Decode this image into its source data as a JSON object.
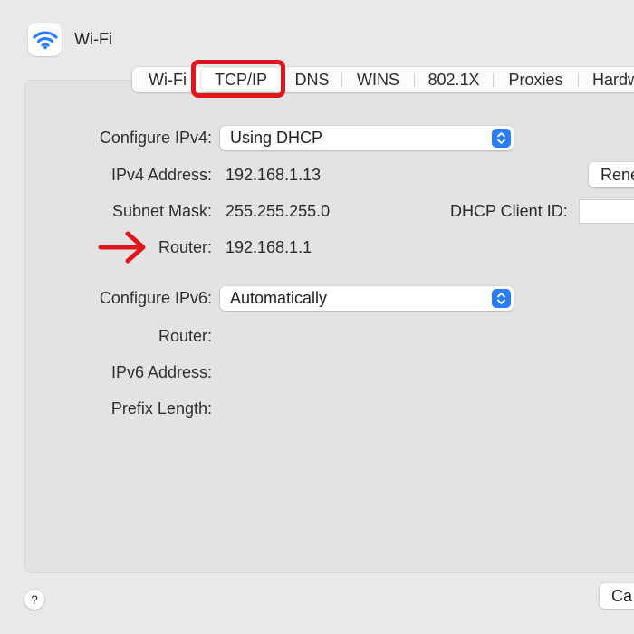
{
  "window": {
    "title": "Wi-Fi",
    "icon": "wifi-icon"
  },
  "tabs": [
    {
      "label": "Wi-Fi"
    },
    {
      "label": "TCP/IP"
    },
    {
      "label": "DNS"
    },
    {
      "label": "WINS"
    },
    {
      "label": "802.1X"
    },
    {
      "label": "Proxies"
    },
    {
      "label": "Hardw"
    }
  ],
  "selected_tab": "TCP/IP",
  "ipv4": {
    "configure_label": "Configure IPv4:",
    "configure_value": "Using DHCP",
    "address_label": "IPv4 Address:",
    "address_value": "192.168.1.13",
    "subnet_label": "Subnet Mask:",
    "subnet_value": "255.255.255.0",
    "router_label": "Router:",
    "router_value": "192.168.1.1",
    "dhcp_client_id_label": "DHCP Client ID:",
    "dhcp_client_id_value": "",
    "renew_button_label": "Rene"
  },
  "ipv6": {
    "configure_label": "Configure IPv6:",
    "configure_value": "Automatically",
    "router_label": "Router:",
    "address_label": "IPv6 Address:",
    "prefix_label": "Prefix Length:"
  },
  "footer": {
    "help_label": "?",
    "cancel_label": "Ca"
  },
  "colors": {
    "accent": "#2a7df6",
    "annotation": "#e0161d",
    "background": "#e9e9e9"
  }
}
